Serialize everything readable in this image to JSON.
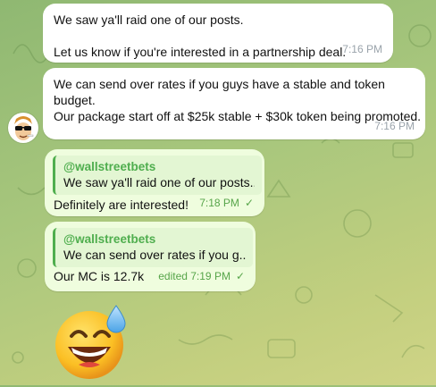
{
  "messages_in": [
    {
      "line1": "We saw ya'll raid one of our posts.",
      "line2": "Let us know if you're interested in a partnership deal.",
      "time": "7:16 PM"
    },
    {
      "line1": "We can send over rates if you guys have a stable and token budget.",
      "line2": "Our package start off at $25k stable + $30k token being promoted.",
      "time": "7:16 PM"
    }
  ],
  "messages_out": [
    {
      "reply_author": "@wallstreetbets",
      "reply_snippet": "We saw ya'll raid one of our posts....",
      "text": "Definitely are interested!",
      "time": "7:18 PM"
    },
    {
      "reply_author": "@wallstreetbets",
      "reply_snippet": "We can send over rates if you g...",
      "text": "Our MC is 12.7k",
      "time": "edited 7:19 PM"
    }
  ],
  "icons": {
    "avatar": "sender-avatar-icon",
    "read_check": "check-icon",
    "sticker": "grinning-sweat-emoji"
  },
  "colors": {
    "accent": "#4fae4e",
    "outgoing_bubble": "#effdde",
    "incoming_bubble": "#ffffff"
  }
}
